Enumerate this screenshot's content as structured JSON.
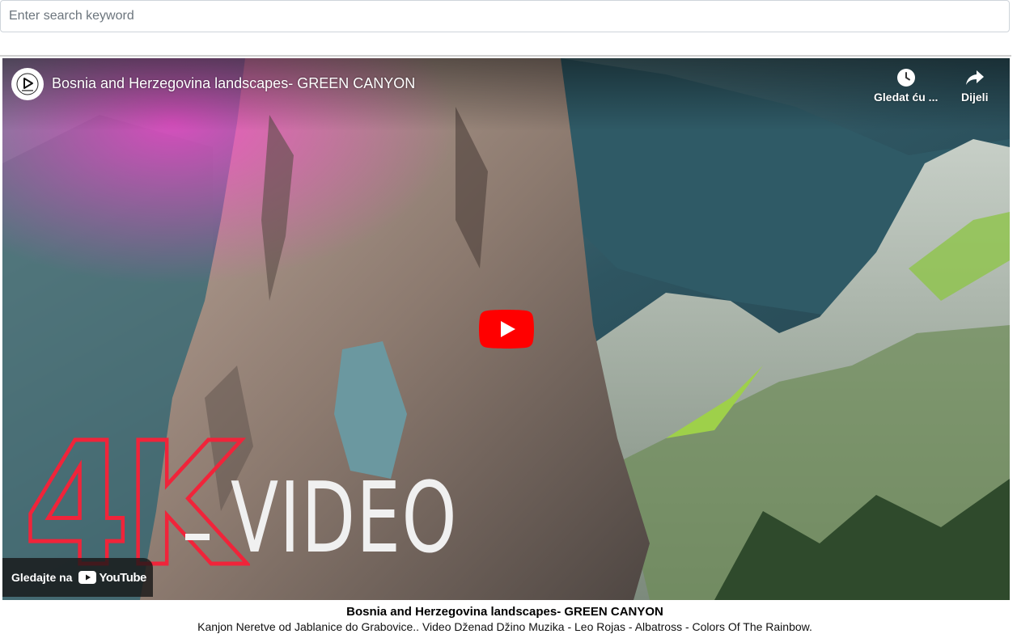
{
  "search": {
    "placeholder": "Enter search keyword",
    "value": ""
  },
  "video": {
    "title": "Bosnia and Herzegovina landscapes- GREEN CANYON",
    "watch_later_label": "Gledat ću ...",
    "share_label": "Dijeli",
    "watch_on_label": "Gledajte na",
    "youtube_wordmark": "YouTube",
    "overlay_big_text": "4K",
    "overlay_text": "VIDEO",
    "play_button_color": "#ff0000"
  },
  "caption": {
    "title": "Bosnia and Herzegovina landscapes- GREEN CANYON",
    "description": "Kanjon Neretve od Jablanice do Grabovice.. Video Dženad Džino Muzika - Leo Rojas - Albatross - Colors Of The Rainbow."
  }
}
